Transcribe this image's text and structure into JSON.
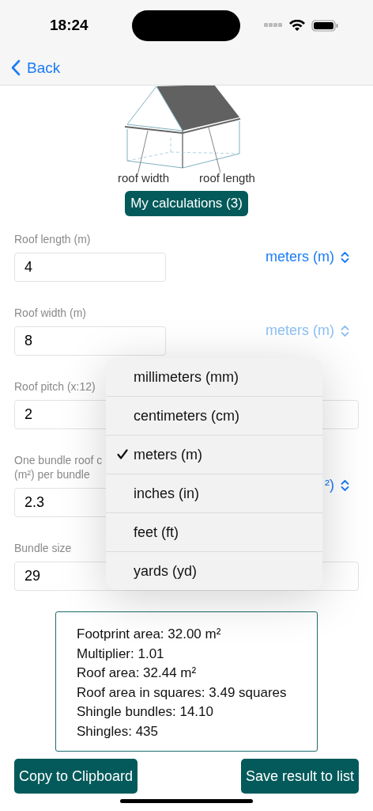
{
  "status_bar": {
    "time": "18:24"
  },
  "nav": {
    "back": "Back"
  },
  "illustration": {
    "labels": [
      "roof width",
      "roof length"
    ]
  },
  "calculations_button": "My calculations (3)",
  "fields": [
    {
      "label_lines": [
        "Roof length (m)"
      ],
      "value": "4",
      "kind": "picker",
      "unit": "meters (m)",
      "open": false
    },
    {
      "label_lines": [
        "Roof width (m)"
      ],
      "value": "8",
      "kind": "picker",
      "unit": "meters (m)",
      "open": true
    },
    {
      "label_lines": [
        "Roof pitch (x:12)"
      ],
      "value": "2",
      "kind": "plain"
    },
    {
      "label_lines": [
        "One bundle roof c",
        "(m²) per bundle"
      ],
      "value": "2.3",
      "kind": "picker",
      "unit": "²)",
      "open": false
    },
    {
      "label_lines": [
        "Bundle size"
      ],
      "value": "29",
      "kind": "plain"
    }
  ],
  "unit_menu": [
    {
      "label": "millimeters (mm)",
      "selected": false
    },
    {
      "label": "centimeters (cm)",
      "selected": false
    },
    {
      "label": "meters (m)",
      "selected": true
    },
    {
      "label": "inches (in)",
      "selected": false
    },
    {
      "label": "feet (ft)",
      "selected": false
    },
    {
      "label": "yards (yd)",
      "selected": false
    }
  ],
  "results": [
    "Footprint area: 32.00 m²",
    "Multiplier: 1.01",
    "Roof area: 32.44 m²",
    "Roof area in squares: 3.49 squares",
    "Shingle bundles: 14.10",
    "Shingles: 435"
  ],
  "actions": [
    "Copy to Clipboard",
    "Save result to list"
  ]
}
